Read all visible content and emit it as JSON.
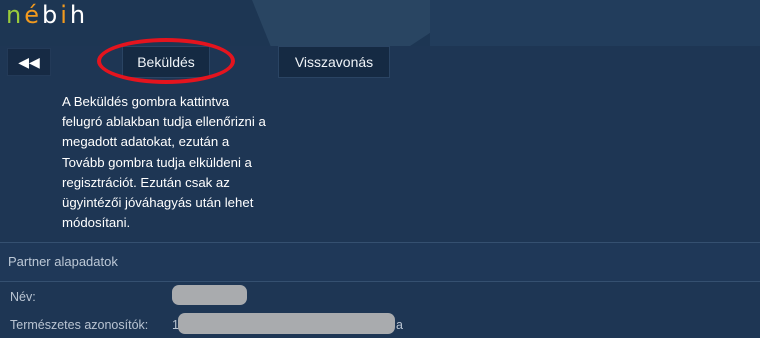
{
  "logo": {
    "c1": "n",
    "c2": "é",
    "c3": "b",
    "c4": "i",
    "c5": "h"
  },
  "toolbar": {
    "back_glyph": "◀◀",
    "submit_label": "Beküldés",
    "undo_label": "Visszavonás"
  },
  "info_text": "A Beküldés gombra kattintva felugró ablakban tudja ellenőrizni a megadott adatokat, ezután a Tovább gombra tudja elküldeni a regisztrációt. Ezután csak az ügyintézői jóváhagyás után lehet módosítani.",
  "section": {
    "title": "Partner alapadatok"
  },
  "fields": {
    "name_label": "Név:",
    "id_label": "Természetes azonosítók:",
    "id_prefix": "1",
    "id_suffix": "a"
  },
  "colors": {
    "background": "#1e3654",
    "logo_green": "#9acb3b",
    "logo_orange": "#f29a1e",
    "annotation_red": "#e4141e"
  }
}
